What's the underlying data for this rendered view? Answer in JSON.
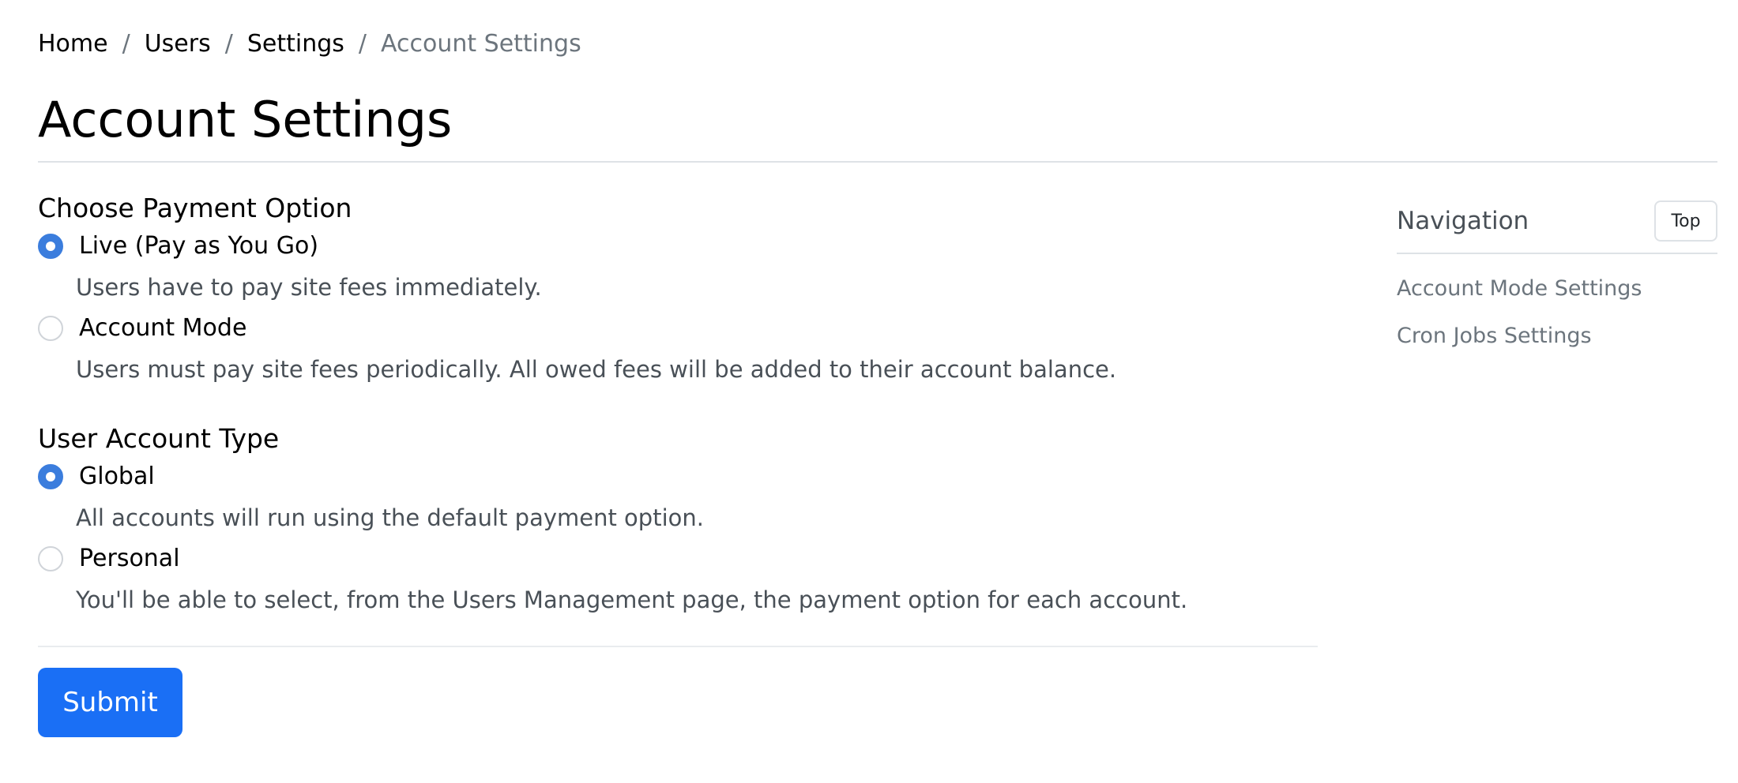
{
  "breadcrumb": {
    "items": [
      "Home",
      "Users",
      "Settings"
    ],
    "separator": "/",
    "current": "Account Settings"
  },
  "page": {
    "title": "Account Settings"
  },
  "payment_option": {
    "title": "Choose Payment Option",
    "options": [
      {
        "label": "Live (Pay as You Go)",
        "description": "Users have to pay site fees immediately.",
        "checked": true
      },
      {
        "label": "Account Mode",
        "description": "Users must pay site fees periodically. All owed fees will be added to their account balance.",
        "checked": false
      }
    ]
  },
  "account_type": {
    "title": "User Account Type",
    "options": [
      {
        "label": "Global",
        "description": "All accounts will run using the default payment option.",
        "checked": true
      },
      {
        "label": "Personal",
        "description": "You'll be able to select, from the Users Management page, the payment option for each account.",
        "checked": false
      }
    ]
  },
  "form": {
    "submit_label": "Submit"
  },
  "navigation": {
    "title": "Navigation",
    "top_label": "Top",
    "links": [
      "Account Mode Settings",
      "Cron Jobs Settings"
    ]
  },
  "colors": {
    "primary": "#1a6ff5",
    "radio_checked": "#3b7ddd",
    "muted_text": "#6c757d"
  }
}
